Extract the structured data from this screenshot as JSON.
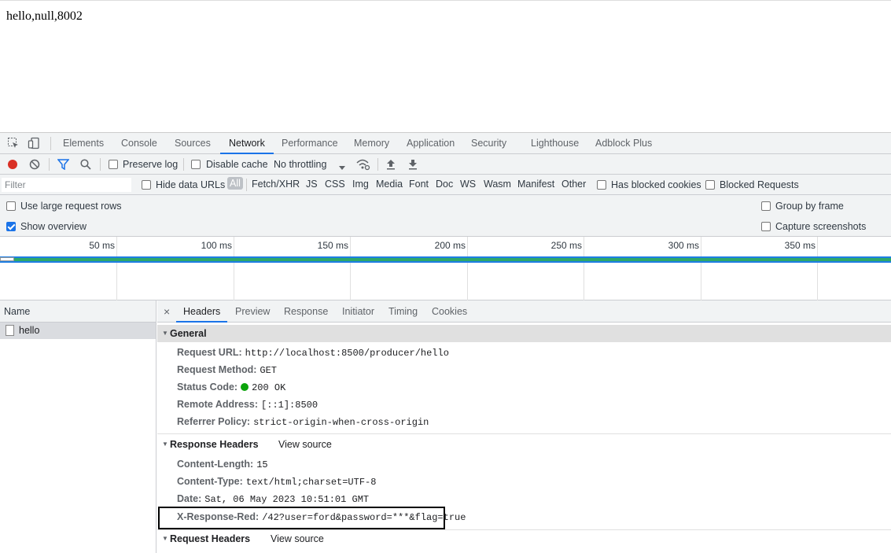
{
  "page": {
    "body_text": "hello,null,8002"
  },
  "devtools": {
    "panel_tabs": [
      "Elements",
      "Console",
      "Sources",
      "Network",
      "Performance",
      "Memory",
      "Application",
      "Security",
      "Lighthouse",
      "Adblock Plus"
    ],
    "active_panel": "Network",
    "toolbar": {
      "preserve_log": "Preserve log",
      "disable_cache": "Disable cache",
      "throttling": "No throttling"
    },
    "filter": {
      "placeholder": "Filter",
      "hide_data_urls": "Hide data URLs",
      "types": [
        "All",
        "Fetch/XHR",
        "JS",
        "CSS",
        "Img",
        "Media",
        "Font",
        "Doc",
        "WS",
        "Wasm",
        "Manifest",
        "Other"
      ],
      "has_blocked_cookies": "Has blocked cookies",
      "blocked_requests": "Blocked Requests"
    },
    "settings": {
      "large_rows": "Use large request rows",
      "show_overview": "Show overview",
      "group_by_frame": "Group by frame",
      "capture_screenshots": "Capture screenshots"
    },
    "overview": {
      "ticks": [
        "50 ms",
        "100 ms",
        "150 ms",
        "200 ms",
        "250 ms",
        "300 ms",
        "350 ms"
      ]
    },
    "request_list": {
      "header": "Name",
      "rows": [
        {
          "name": "hello"
        }
      ]
    },
    "detail": {
      "close": "×",
      "tabs": [
        "Headers",
        "Preview",
        "Response",
        "Initiator",
        "Timing",
        "Cookies"
      ],
      "active_tab": "Headers",
      "general": {
        "title": "General",
        "rows": [
          {
            "key": "Request URL:",
            "value": "http://localhost:8500/producer/hello"
          },
          {
            "key": "Request Method:",
            "value": "GET"
          },
          {
            "key": "Status Code:",
            "value": "200 OK"
          },
          {
            "key": "Remote Address:",
            "value": "[::1]:8500"
          },
          {
            "key": "Referrer Policy:",
            "value": "strict-origin-when-cross-origin"
          }
        ]
      },
      "response_headers": {
        "title": "Response Headers",
        "view_source": "View source",
        "rows": [
          {
            "key": "Content-Length:",
            "value": "15"
          },
          {
            "key": "Content-Type:",
            "value": "text/html;charset=UTF-8"
          },
          {
            "key": "Date:",
            "value": "Sat, 06 May 2023 10:51:01 GMT"
          },
          {
            "key": "X-Response-Red:",
            "value": "/42?user=ford&password=***&flag=true"
          }
        ]
      },
      "request_headers": {
        "title": "Request Headers",
        "view_source": "View source"
      }
    }
  }
}
